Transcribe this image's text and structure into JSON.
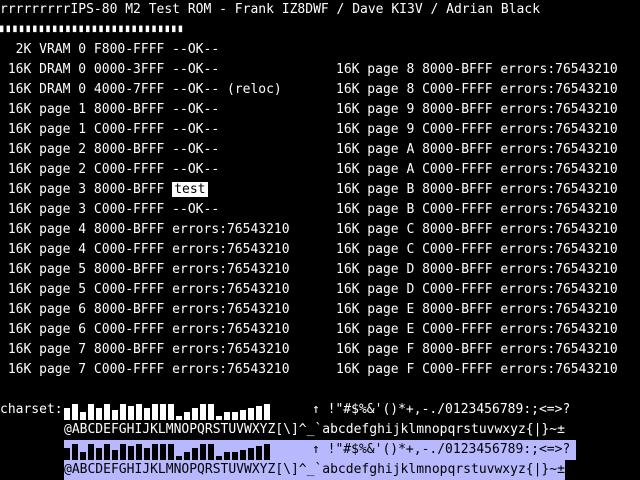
{
  "title": "rrrrrrrrrIPS-80 M2 Test ROM - Frank IZ8DWF / Dave KI3V / Adrian Black",
  "separator": "▘▘▘▘▘▘▘▘▘▘▘▘▘▘▘▘▘▘▘▘▘▘▘▘▘▘▘▘",
  "left_rows": [
    {
      "text": "  2K VRAM 0 F800-FFFF --OK--"
    },
    {
      "text": " 16K DRAM 0 0000-3FFF --OK--"
    },
    {
      "text": " 16K DRAM 0 4000-7FFF --OK-- (reloc)"
    },
    {
      "text": " 16K page 1 8000-BFFF --OK--"
    },
    {
      "text": " 16K page 1 C000-FFFF --OK--"
    },
    {
      "text": " 16K page 2 8000-BFFF --OK--"
    },
    {
      "text": " 16K page 2 C000-FFFF --OK--"
    },
    {
      "text": " 16K page 3 8000-BFFF ",
      "badge": "test"
    },
    {
      "text": " 16K page 3 C000-FFFF --OK--"
    },
    {
      "text": " 16K page 4 8000-BFFF errors:76543210"
    },
    {
      "text": " 16K page 4 C000-FFFF errors:76543210"
    },
    {
      "text": " 16K page 5 8000-BFFF errors:76543210"
    },
    {
      "text": " 16K page 5 C000-FFFF errors:76543210"
    },
    {
      "text": " 16K page 6 8000-BFFF errors:76543210"
    },
    {
      "text": " 16K page 6 C000-FFFF errors:76543210"
    },
    {
      "text": " 16K page 7 8000-BFFF errors:76543210"
    },
    {
      "text": " 16K page 7 C000-FFFF errors:76543210"
    }
  ],
  "right_rows": [
    "16K page 8 8000-BFFF errors:76543210",
    "16K page 8 C000-FFFF errors:76543210",
    "16K page 9 8000-BFFF errors:76543210",
    "16K page 9 C000-FFFF errors:76543210",
    "16K page A 8000-BFFF errors:76543210",
    "16K page A C000-FFFF errors:76543210",
    "16K page B 8000-BFFF errors:76543210",
    "16K page B C000-FFFF errors:76543210",
    "16K page C 8000-BFFF errors:76543210",
    "16K page C C000-FFFF errors:76543210",
    "16K page D 8000-BFFF errors:76543210",
    "16K page D C000-FFFF errors:76543210",
    "16K page E 8000-BFFF errors:76543210",
    "16K page E C000-FFFF errors:76543210",
    "16K page F 8000-BFFF errors:76543210",
    "16K page F C000-FFFF errors:76543210"
  ],
  "charset": {
    "label": "charset:",
    "line1_tail": "↑ !\"#$%&'()*+,-./0123456789:;<=>?",
    "line2": "@ABCDEFGHIJKLMNOPQRSTUVWXYZ[\\]^_`abcdefghijklmnopqrstuvwxyz{|}~±",
    "line3_tail": "↑ !\"#$%&'()*+,-./0123456789:;<=>?",
    "line4": "@ABCDEFGHIJKLMNOPQRSTUVWXYZ[\\]^_`abcdefghijklmnopqrstuvwxyz{|}~±"
  }
}
